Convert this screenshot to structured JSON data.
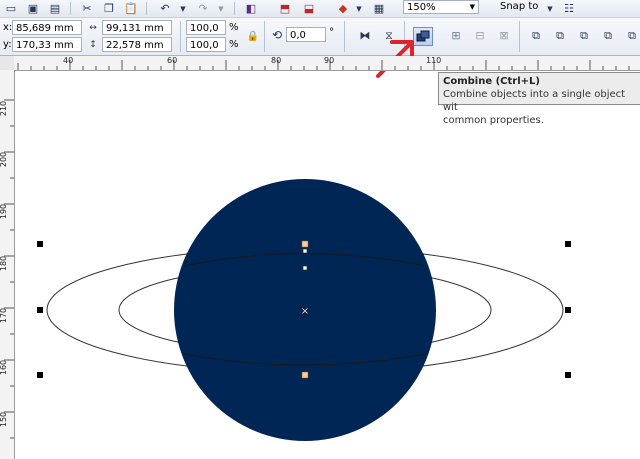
{
  "toolbar": {
    "zoom_value": "150%",
    "snap_label": "Snap to"
  },
  "properties": {
    "x_label": "x:",
    "x_value": "85,689 mm",
    "y_label": "y:",
    "y_value": "170,33 mm",
    "width_value": "99,131 mm",
    "height_value": "22,578 mm",
    "scale_x": "100,0",
    "scale_y": "100,0",
    "percent_symbol": "%",
    "rotation_value": "0,0",
    "degree_symbol": "°"
  },
  "ruler": {
    "horizontal_ticks": [
      "40",
      "60",
      "80",
      "90",
      "110"
    ],
    "vertical_ticks": [
      "210",
      "200",
      "190",
      "180",
      "170",
      "160",
      "150"
    ]
  },
  "tooltip": {
    "title": "Combine (Ctrl+L)",
    "line1": "Combine  objects into a single object wit",
    "line2": "common properties."
  },
  "colors": {
    "circle_fill": "#002655",
    "arrow": "#e0232a",
    "handle_fill": "#ffcc99"
  }
}
